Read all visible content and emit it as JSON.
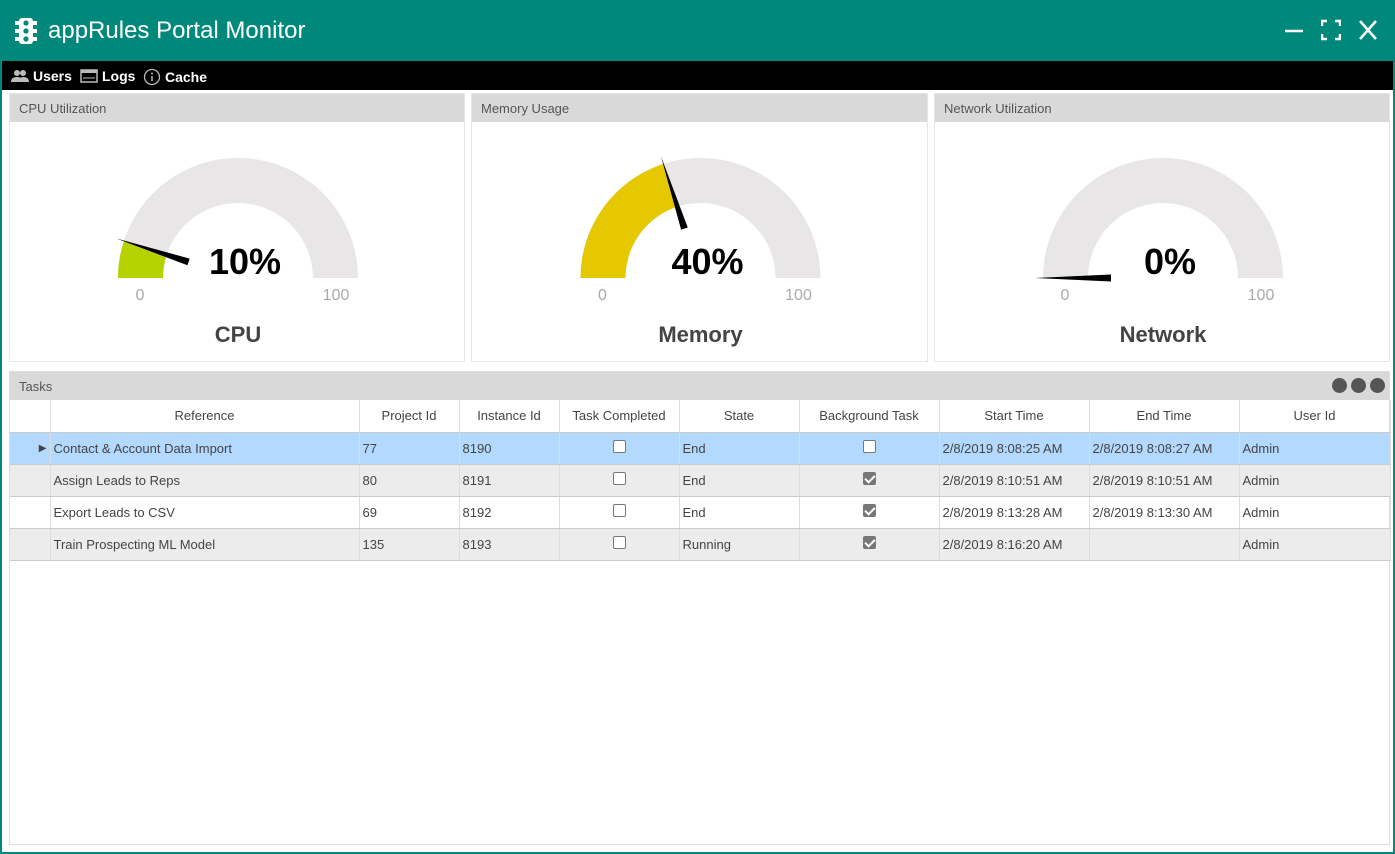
{
  "window": {
    "title": "appRules Portal Monitor",
    "logo_icon": "traffic-light-icon",
    "accent": "#00897b"
  },
  "toolbar": {
    "items": [
      {
        "label": "Users",
        "icon": "users-icon"
      },
      {
        "label": "Logs",
        "icon": "logs-icon"
      },
      {
        "label": "Cache",
        "icon": "info-icon"
      }
    ]
  },
  "gauges": [
    {
      "header": "CPU Utilization",
      "value": 10,
      "value_label": "10%",
      "min": "0",
      "max": "100",
      "name": "CPU",
      "color": "#b5d300"
    },
    {
      "header": "Memory Usage",
      "value": 40,
      "value_label": "40%",
      "min": "0",
      "max": "100",
      "name": "Memory",
      "color": "#e6c800"
    },
    {
      "header": "Network Utilization",
      "value": 0,
      "value_label": "0%",
      "min": "0",
      "max": "100",
      "name": "Network",
      "color": "#b5d300"
    }
  ],
  "tasks": {
    "header": "Tasks",
    "columns": [
      "Reference",
      "Project Id",
      "Instance Id",
      "Task Completed",
      "State",
      "Background Task",
      "Start Time",
      "End Time",
      "User Id"
    ],
    "rows": [
      {
        "ref": "Contact & Account Data Import",
        "project": "77",
        "instance": "8190",
        "completed": false,
        "state": "End",
        "background": false,
        "start": "2/8/2019 8:08:25 AM",
        "end": "2/8/2019 8:08:27 AM",
        "user": "Admin",
        "selected": true
      },
      {
        "ref": "Assign Leads to Reps",
        "project": "80",
        "instance": "8191",
        "completed": false,
        "state": "End",
        "background": true,
        "start": "2/8/2019 8:10:51 AM",
        "end": "2/8/2019 8:10:51 AM",
        "user": "Admin"
      },
      {
        "ref": "Export Leads to CSV",
        "project": "69",
        "instance": "8192",
        "completed": false,
        "state": "End",
        "background": true,
        "start": "2/8/2019 8:13:28 AM",
        "end": "2/8/2019 8:13:30 AM",
        "user": "Admin"
      },
      {
        "ref": "Train Prospecting ML Model",
        "project": "135",
        "instance": "8193",
        "completed": false,
        "state": "Running",
        "background": true,
        "start": "2/8/2019 8:16:20 AM",
        "end": "",
        "user": "Admin"
      }
    ]
  }
}
